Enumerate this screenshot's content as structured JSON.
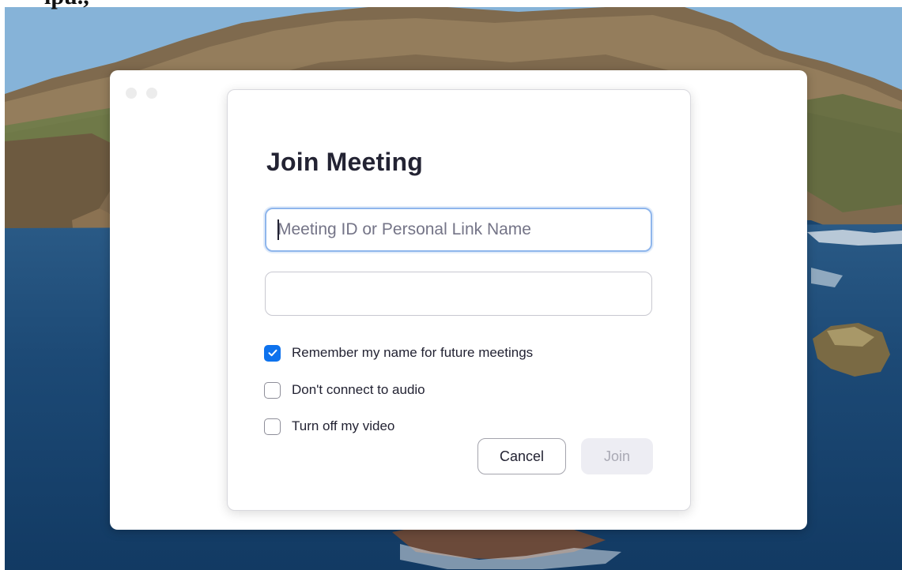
{
  "header_text": "ipu.,",
  "window": {
    "title": "Join Meeting",
    "meeting_id_field": {
      "value": "",
      "placeholder": "Meeting ID or Personal Link Name"
    },
    "name_field": {
      "value": "",
      "placeholder": ""
    },
    "options": [
      {
        "label": "Remember my name for future meetings",
        "checked": true
      },
      {
        "label": "Don't connect to audio",
        "checked": false
      },
      {
        "label": "Turn off my video",
        "checked": false
      }
    ],
    "buttons": {
      "cancel": "Cancel",
      "join": "Join"
    }
  },
  "colors": {
    "accent": "#0e72ed",
    "focus_ring": "#8fb6ec",
    "title_text": "#232333",
    "disabled_button_bg": "#ededf3",
    "disabled_button_text": "#a9a9b4"
  },
  "icons": {
    "checkmark": "checkmark-icon",
    "window_controls": "window-control-dot"
  }
}
